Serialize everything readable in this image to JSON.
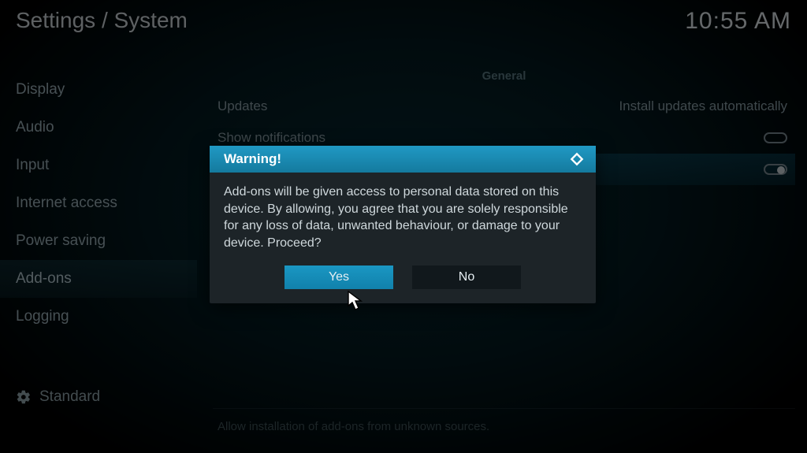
{
  "header": {
    "breadcrumb": "Settings / System",
    "clock": "10:55 AM"
  },
  "sidebar": {
    "items": [
      {
        "label": "Display"
      },
      {
        "label": "Audio"
      },
      {
        "label": "Input"
      },
      {
        "label": "Internet access"
      },
      {
        "label": "Power saving"
      },
      {
        "label": "Add-ons",
        "selected": true
      },
      {
        "label": "Logging"
      }
    ],
    "level_label": "Standard"
  },
  "settings": {
    "section_heading": "General",
    "rows": [
      {
        "label": "Updates",
        "value": "Install updates automatically"
      },
      {
        "label": "Show notifications",
        "toggle": "off"
      },
      {
        "label": "",
        "toggle": "on",
        "highlight": true
      }
    ],
    "description": "Allow installation of add-ons from unknown sources."
  },
  "dialog": {
    "title": "Warning!",
    "body": "Add-ons will be given access to personal data stored on this device. By allowing, you agree that you are solely responsible for any loss of data, unwanted behaviour, or damage to your device. Proceed?",
    "yes_label": "Yes",
    "no_label": "No"
  }
}
